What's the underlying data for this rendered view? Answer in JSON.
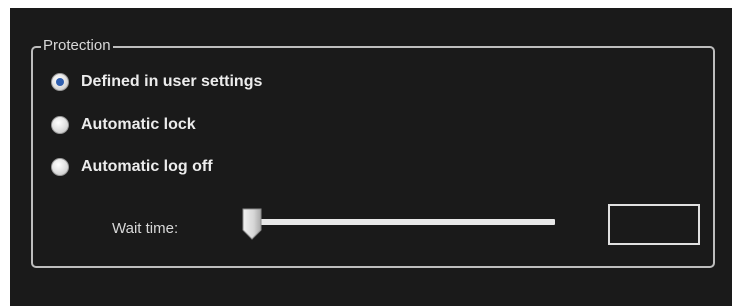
{
  "protection": {
    "group_title": "Protection",
    "options": [
      {
        "label": "Defined in user settings",
        "checked": true
      },
      {
        "label": "Automatic lock",
        "checked": false
      },
      {
        "label": "Automatic log off",
        "checked": false
      }
    ],
    "wait_time": {
      "label": "Wait time:",
      "slider_value_fraction": 0.0,
      "input_value": ""
    }
  },
  "colors": {
    "background": "#1a1a1a",
    "border": "#bdbdbd",
    "text": "#ececec",
    "radio_selected": "#2f5fb0"
  },
  "icons": {
    "radio": "radio-button-icon",
    "slider_thumb": "slider-thumb-icon"
  }
}
